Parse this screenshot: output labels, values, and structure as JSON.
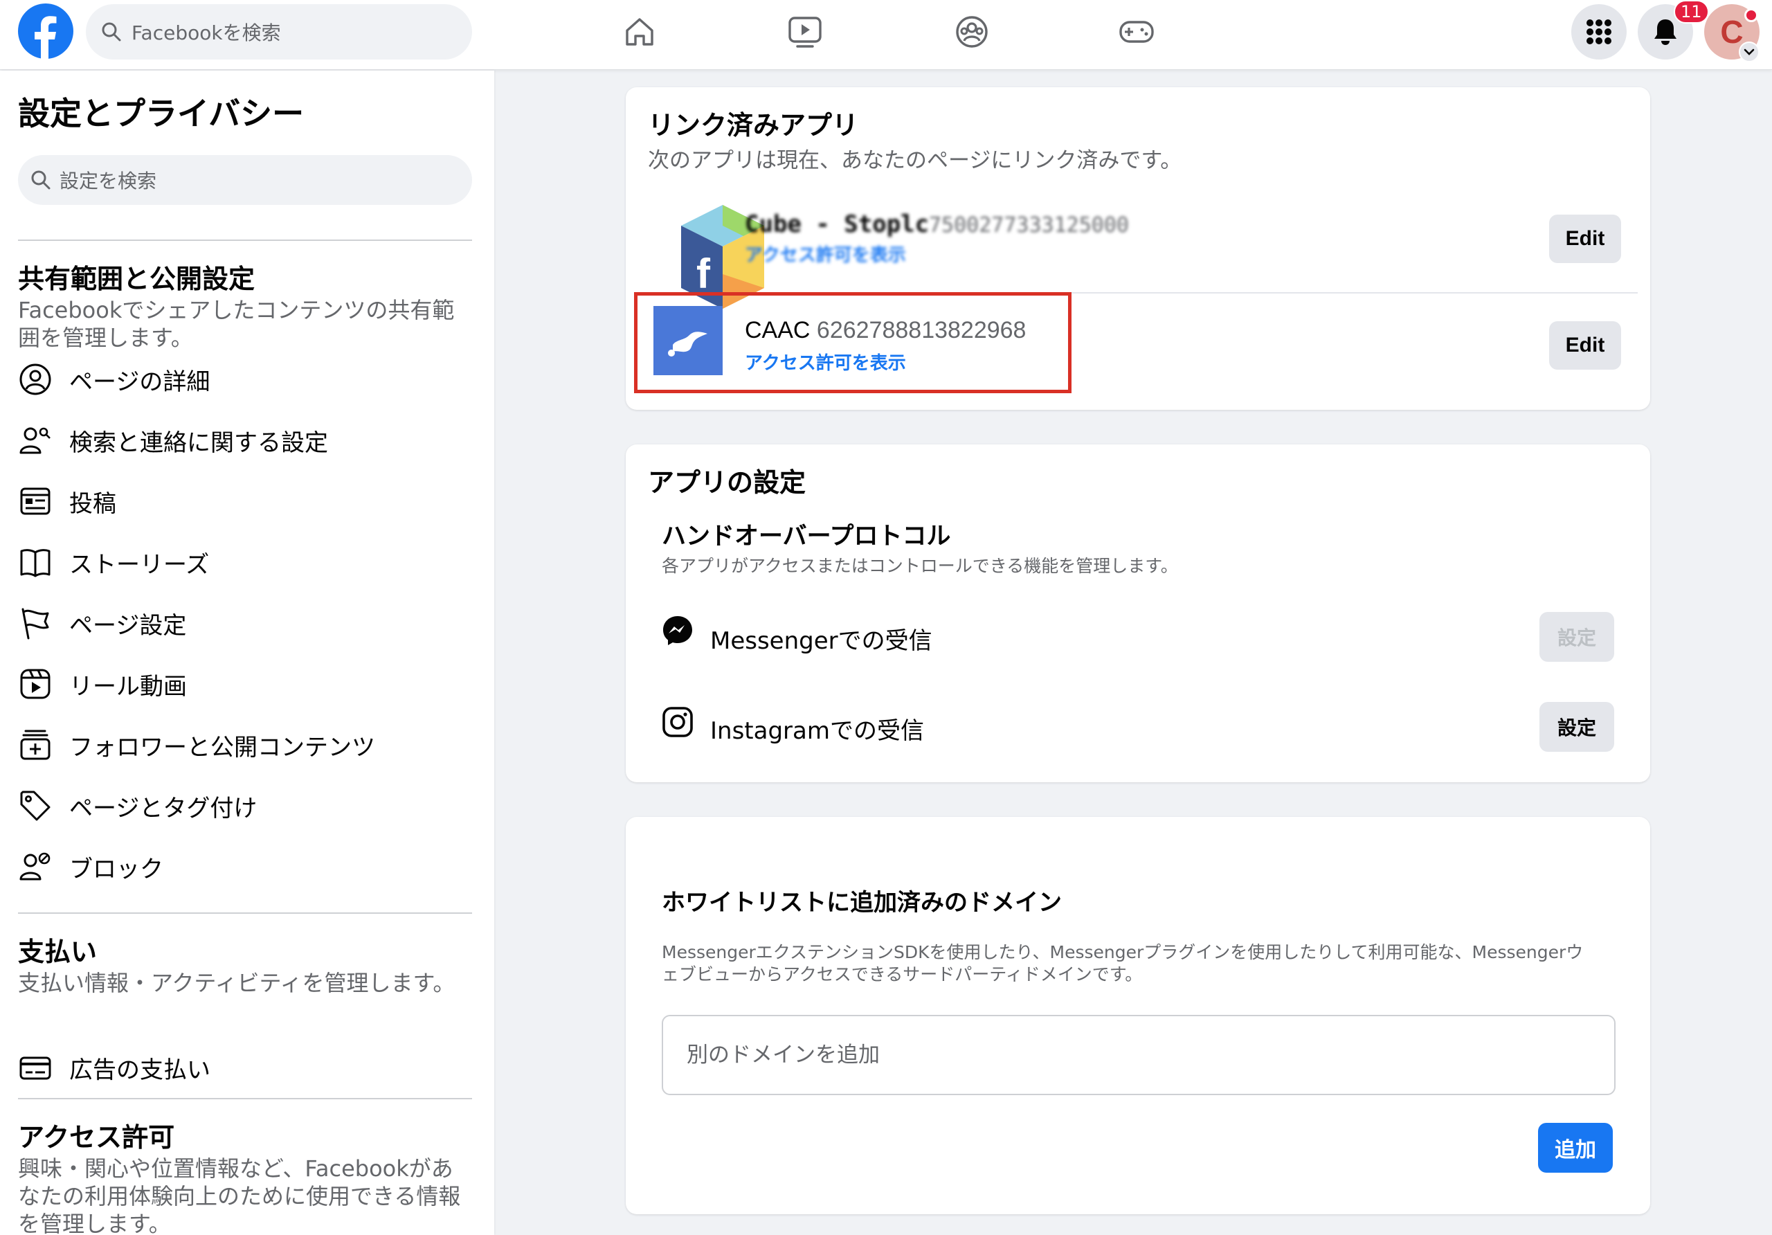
{
  "topbar": {
    "search_placeholder": "Facebookを検索",
    "notification_count": "11",
    "avatar_initial": "C",
    "brand_color": "#1877f2",
    "nav_icons": [
      "home-icon",
      "video-icon",
      "groups-icon",
      "gaming-icon"
    ]
  },
  "sidebar": {
    "title": "設定とプライバシー",
    "search_placeholder": "設定を検索",
    "sections": [
      {
        "title": "共有範囲と公開設定",
        "description": "Facebookでシェアしたコンテンツの共有範囲を管理します。",
        "items": [
          {
            "label": "ページの詳細",
            "icon": "person-circle-icon"
          },
          {
            "label": "検索と連絡に関する設定",
            "icon": "people-search-icon"
          },
          {
            "label": "投稿",
            "icon": "post-icon"
          },
          {
            "label": "ストーリーズ",
            "icon": "book-icon"
          },
          {
            "label": "ページ設定",
            "icon": "flag-icon"
          },
          {
            "label": "リール動画",
            "icon": "reels-icon"
          },
          {
            "label": "フォロワーと公開コンテンツ",
            "icon": "add-box-icon"
          },
          {
            "label": "ページとタグ付け",
            "icon": "tag-icon"
          },
          {
            "label": "ブロック",
            "icon": "block-user-icon"
          }
        ]
      },
      {
        "title": "支払い",
        "description": "支払い情報・アクティビティを管理します。",
        "items": [
          {
            "label": "広告の支払い",
            "icon": "credit-card-icon"
          }
        ]
      },
      {
        "title": "アクセス許可",
        "description": "興味・関心や位置情報など、Facebookがあなたの利用体験向上のために使用できる情報を管理します。"
      }
    ]
  },
  "linked_apps": {
    "title": "リンク済みアプリ",
    "subtitle": "次のアプリは現在、あなたのページにリンク済みです。",
    "apps": [
      {
        "name": "Cube - Stoplc",
        "id": "7500277333125000",
        "link": "アクセス許可を表示",
        "edit_label": "Edit"
      },
      {
        "name": "CAAC",
        "id": "6262788813822968",
        "link": "アクセス許可を表示",
        "edit_label": "Edit"
      }
    ],
    "highlight_color": "#d93025"
  },
  "app_settings": {
    "title": "アプリの設定",
    "handover_title": "ハンドオーバープロトコル",
    "handover_desc": "各アプリがアクセスまたはコントロールできる機能を管理します。",
    "rows": [
      {
        "label": "Messengerでの受信",
        "icon": "messenger-icon",
        "button": "設定",
        "enabled": false
      },
      {
        "label": "Instagramでの受信",
        "icon": "instagram-icon",
        "button": "設定",
        "enabled": true
      }
    ]
  },
  "whitelist": {
    "title": "ホワイトリストに追加済みのドメイン",
    "desc_line1": "MessengerエクステンションSDKを使用したり、Messengerプラグインを使用したりして利用可能な、Messengerウ",
    "desc_line2": "ェブビューからアクセスできるサードパーティドメインです。",
    "input_placeholder": "別のドメインを追加",
    "add_label": "追加"
  }
}
